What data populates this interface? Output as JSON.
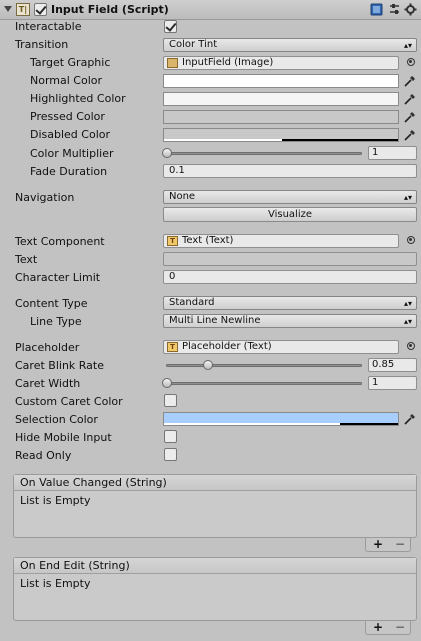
{
  "header": {
    "title": "Input Field (Script)",
    "component_icon": "script-component-icon",
    "enabled": true
  },
  "fields": {
    "interactable": {
      "label": "Interactable",
      "checked": true
    },
    "transition": {
      "label": "Transition",
      "value": "Color Tint"
    },
    "target_graphic": {
      "label": "Target Graphic",
      "value": "InputField (Image)"
    },
    "normal_color": {
      "label": "Normal Color",
      "color": "#ffffff"
    },
    "highlighted_color": {
      "label": "Highlighted Color",
      "color": "#f5f5f5"
    },
    "pressed_color": {
      "label": "Pressed Color",
      "color": "#c8c8c8"
    },
    "disabled_color": {
      "label": "Disabled Color",
      "color": "#c8c8c8",
      "alpha_fraction": 0.5
    },
    "color_multiplier": {
      "label": "Color Multiplier",
      "value": "1",
      "slider_fraction": 0.0
    },
    "fade_duration": {
      "label": "Fade Duration",
      "value": "0.1"
    },
    "navigation": {
      "label": "Navigation",
      "value": "None"
    },
    "visualize_button": "Visualize",
    "text_component": {
      "label": "Text Component",
      "value": "Text (Text)"
    },
    "text": {
      "label": "Text",
      "value": ""
    },
    "character_limit": {
      "label": "Character Limit",
      "value": "0"
    },
    "content_type": {
      "label": "Content Type",
      "value": "Standard"
    },
    "line_type": {
      "label": "Line Type",
      "value": "Multi Line Newline"
    },
    "placeholder": {
      "label": "Placeholder",
      "value": "Placeholder (Text)"
    },
    "caret_blink_rate": {
      "label": "Caret Blink Rate",
      "value": "0.85",
      "slider_fraction": 0.21
    },
    "caret_width": {
      "label": "Caret Width",
      "value": "1",
      "slider_fraction": 0.0
    },
    "custom_caret_color": {
      "label": "Custom Caret Color",
      "checked": false
    },
    "selection_color": {
      "label": "Selection Color",
      "color": "#a8cefe",
      "alpha_fraction": 0.75
    },
    "hide_mobile_input": {
      "label": "Hide Mobile Input",
      "checked": false
    },
    "read_only": {
      "label": "Read Only",
      "checked": false
    }
  },
  "events": [
    {
      "header": "On Value Changed (String)",
      "body": "List is Empty",
      "add": "+",
      "remove": "−"
    },
    {
      "header": "On End Edit (String)",
      "body": "List is Empty",
      "add": "+",
      "remove": "−"
    }
  ],
  "colors": {
    "background": "#c2c2c2",
    "selection": "#a8cefe",
    "picker_accent": "#333333"
  }
}
